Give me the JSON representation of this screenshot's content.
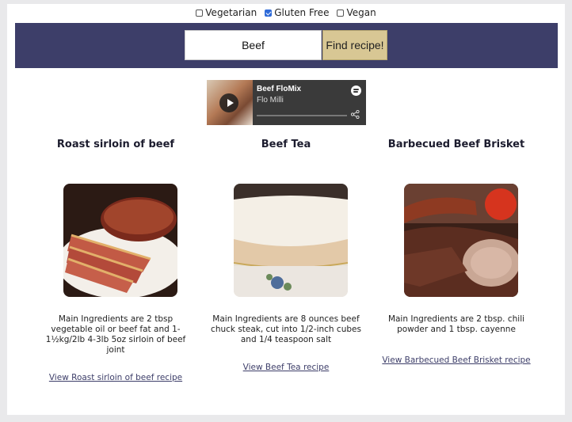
{
  "filters": [
    {
      "label": "Vegetarian",
      "checked": false
    },
    {
      "label": "Gluten Free",
      "checked": true
    },
    {
      "label": "Vegan",
      "checked": false
    }
  ],
  "search": {
    "value": "Beef",
    "button_label": "Find recipe!"
  },
  "player": {
    "title": "Beef FloMix",
    "artist": "Flo Milli"
  },
  "recipes": [
    {
      "title": "Roast sirloin of beef",
      "description": "Main Ingredients are 2 tbsp vegetable oil or beef fat and 1-1½kg/2lb 4-3lb 5oz sirloin of beef joint",
      "link": "View Roast sirloin of beef recipe"
    },
    {
      "title": "Beef Tea",
      "description": "Main Ingredients are 8 ounces beef chuck steak, cut into 1/2-inch cubes and 1/4 teaspoon salt",
      "link": "View Beef Tea recipe"
    },
    {
      "title": "Barbecued Beef Brisket",
      "description": "Main Ingredients are 2 tbsp. chili powder and 1 tbsp. cayenne",
      "link": "View Barbecued Beef Brisket recipe"
    }
  ],
  "colors": {
    "header": "#3d3e69",
    "button": "#d8c794",
    "link": "#3d3e69"
  }
}
